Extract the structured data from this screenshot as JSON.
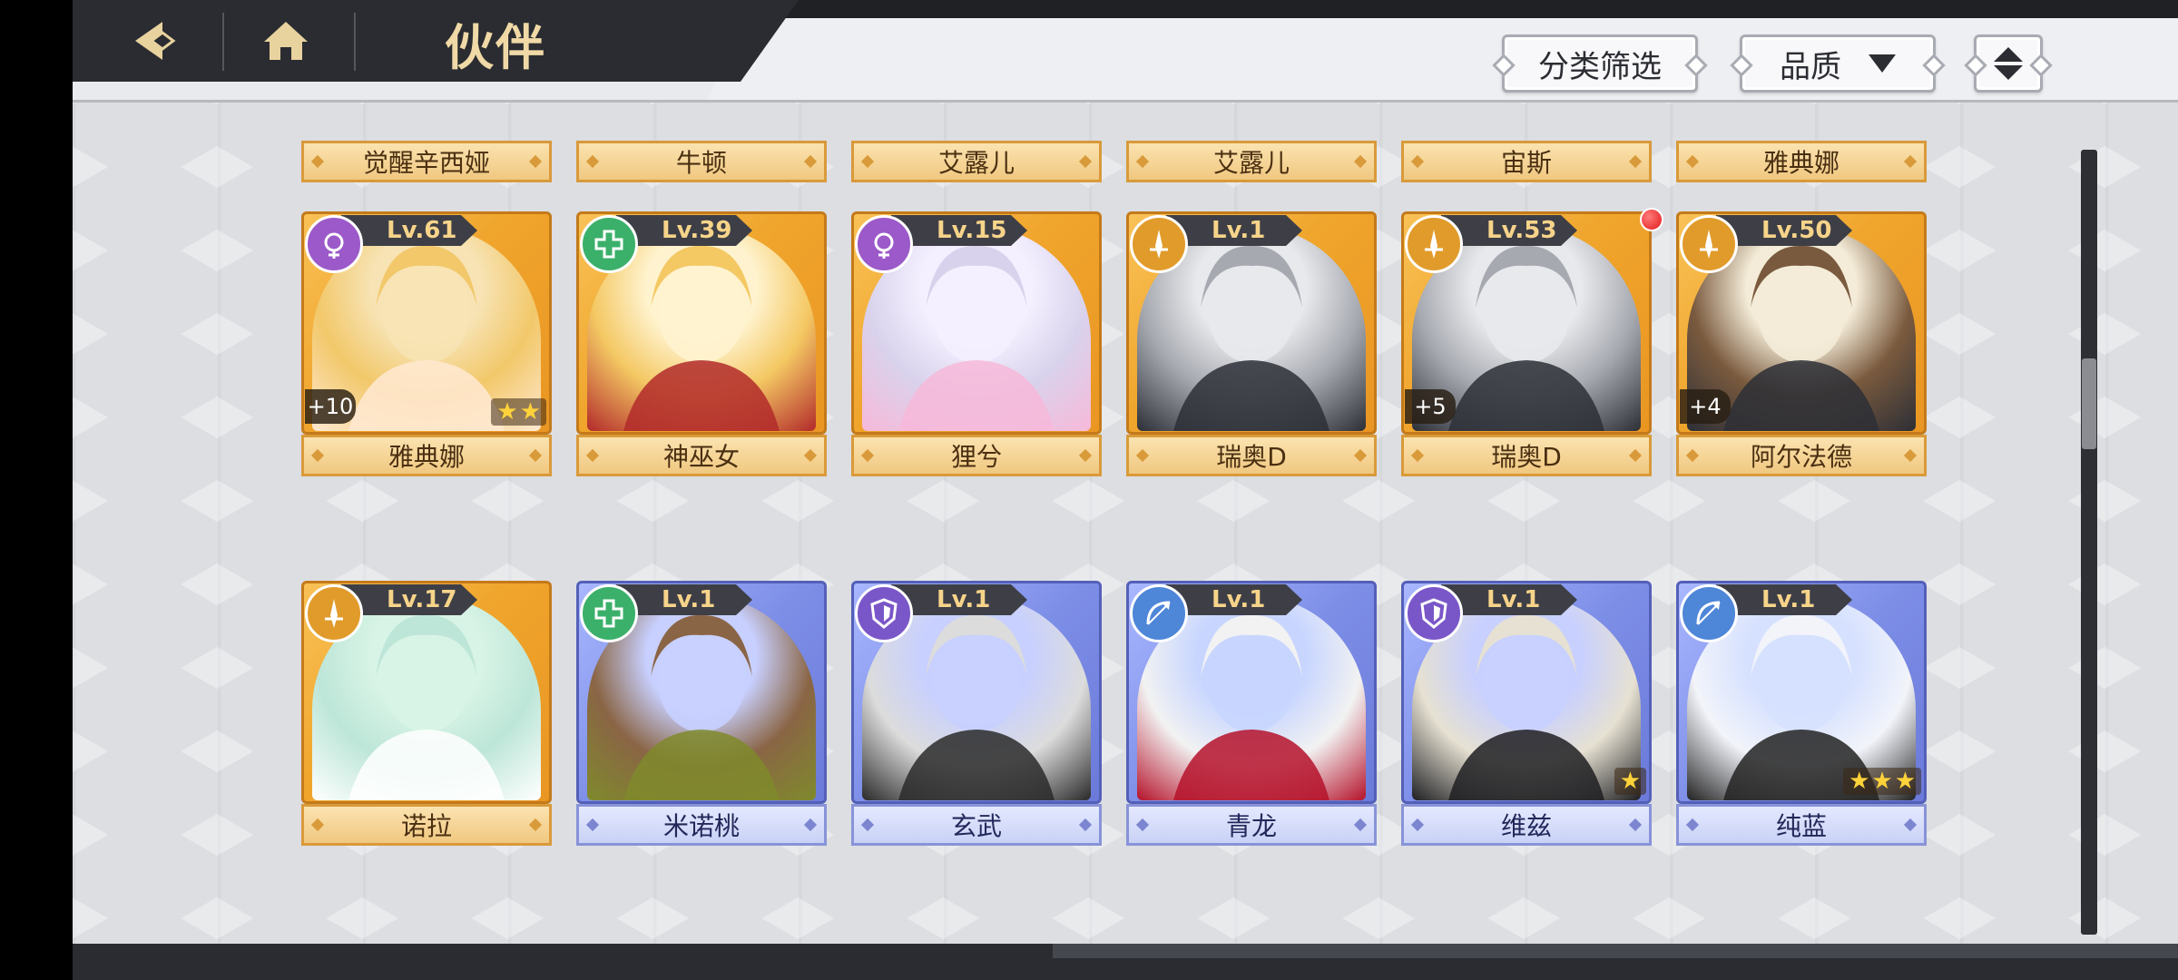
{
  "header": {
    "title": "伙伴",
    "filter_label": "分类筛选",
    "quality_label": "品质"
  },
  "top_row_names": [
    "觉醒辛西娅",
    "牛顿",
    "艾露儿",
    "艾露儿",
    "宙斯",
    "雅典娜"
  ],
  "cards": [
    {
      "name": "雅典娜",
      "level": "Lv.61",
      "element": "purple-orb",
      "plus": "+10",
      "stars": 2,
      "rarity": "gold"
    },
    {
      "name": "神巫女",
      "level": "Lv.39",
      "element": "green-cross",
      "plus": "",
      "stars": 0,
      "rarity": "gold"
    },
    {
      "name": "狸兮",
      "level": "Lv.15",
      "element": "purple-orb",
      "plus": "",
      "stars": 0,
      "rarity": "gold"
    },
    {
      "name": "瑞奥D",
      "level": "Lv.1",
      "element": "gold-sword",
      "plus": "",
      "stars": 0,
      "rarity": "gold"
    },
    {
      "name": "瑞奥D",
      "level": "Lv.53",
      "element": "gold-sword",
      "plus": "+5",
      "stars": 0,
      "rarity": "gold"
    },
    {
      "name": "阿尔法德",
      "level": "Lv.50",
      "element": "gold-sword",
      "plus": "+4",
      "stars": 0,
      "rarity": "gold"
    },
    {
      "name": "诺拉",
      "level": "Lv.17",
      "element": "gold-sword",
      "plus": "",
      "stars": 0,
      "rarity": "gold"
    },
    {
      "name": "米诺桃",
      "level": "Lv.1",
      "element": "green-cross",
      "plus": "",
      "stars": 0,
      "rarity": "blue"
    },
    {
      "name": "玄武",
      "level": "Lv.1",
      "element": "purple-shield",
      "plus": "",
      "stars": 0,
      "rarity": "blue"
    },
    {
      "name": "青龙",
      "level": "Lv.1",
      "element": "blue-bow",
      "plus": "",
      "stars": 0,
      "rarity": "blue"
    },
    {
      "name": "维兹",
      "level": "Lv.1",
      "element": "purple-shield",
      "plus": "",
      "stars": 1,
      "rarity": "blue"
    },
    {
      "name": "纯蓝",
      "level": "Lv.1",
      "element": "blue-bow",
      "plus": "",
      "stars": 3,
      "rarity": "blue"
    }
  ],
  "colors": {
    "gold_frame": "#f0a52c",
    "blue_frame": "#7d8ee7",
    "notification_dot": "#e21818"
  }
}
